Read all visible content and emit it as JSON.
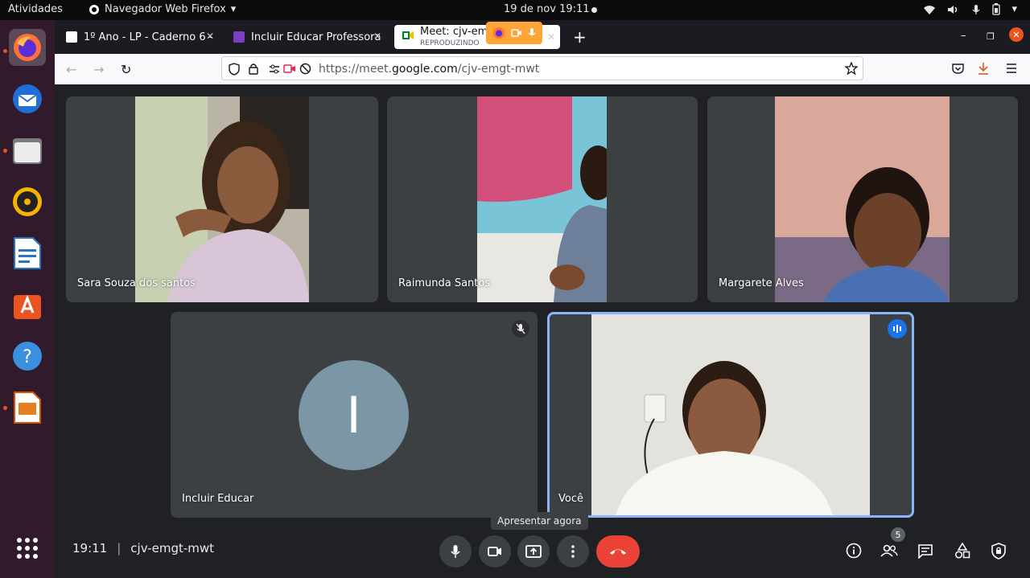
{
  "topbar": {
    "activities": "Atividades",
    "app_name": "Navegador Web Firefox",
    "clock": "19 de nov  19:11"
  },
  "dock": {
    "apps": [
      "firefox-icon",
      "thunderbird-icon",
      "files-icon",
      "rhythmbox-icon",
      "writer-icon",
      "software-icon",
      "help-icon",
      "impress-icon",
      "app-grid-icon"
    ]
  },
  "browser": {
    "tabs": [
      {
        "label": "1º Ano - LP - Caderno 6 - "
      },
      {
        "label": "Incluir Educar Professora"
      },
      {
        "label": "Meet: cjv-emgt-mwt",
        "sublabel": "REPRODUZINDO"
      }
    ],
    "url_prefix": "https://meet.",
    "url_domain": "google.com",
    "url_path": "/cjv-emgt-mwt"
  },
  "meet": {
    "participants": [
      {
        "name": "Sara Souza dos santos"
      },
      {
        "name": "Raimunda Santos"
      },
      {
        "name": "Margarete Alves"
      },
      {
        "name": "Incluir Educar",
        "initial": "I"
      },
      {
        "name": "Você"
      }
    ],
    "tooltip": "Apresentar agora",
    "time": "19:11",
    "separator": "|",
    "meeting_code": "cjv-emgt-mwt",
    "participant_count": "5",
    "colors": {
      "end_call": "#ea4335",
      "speaking": "#1a73e8",
      "avatar": "#7b96a4"
    }
  }
}
